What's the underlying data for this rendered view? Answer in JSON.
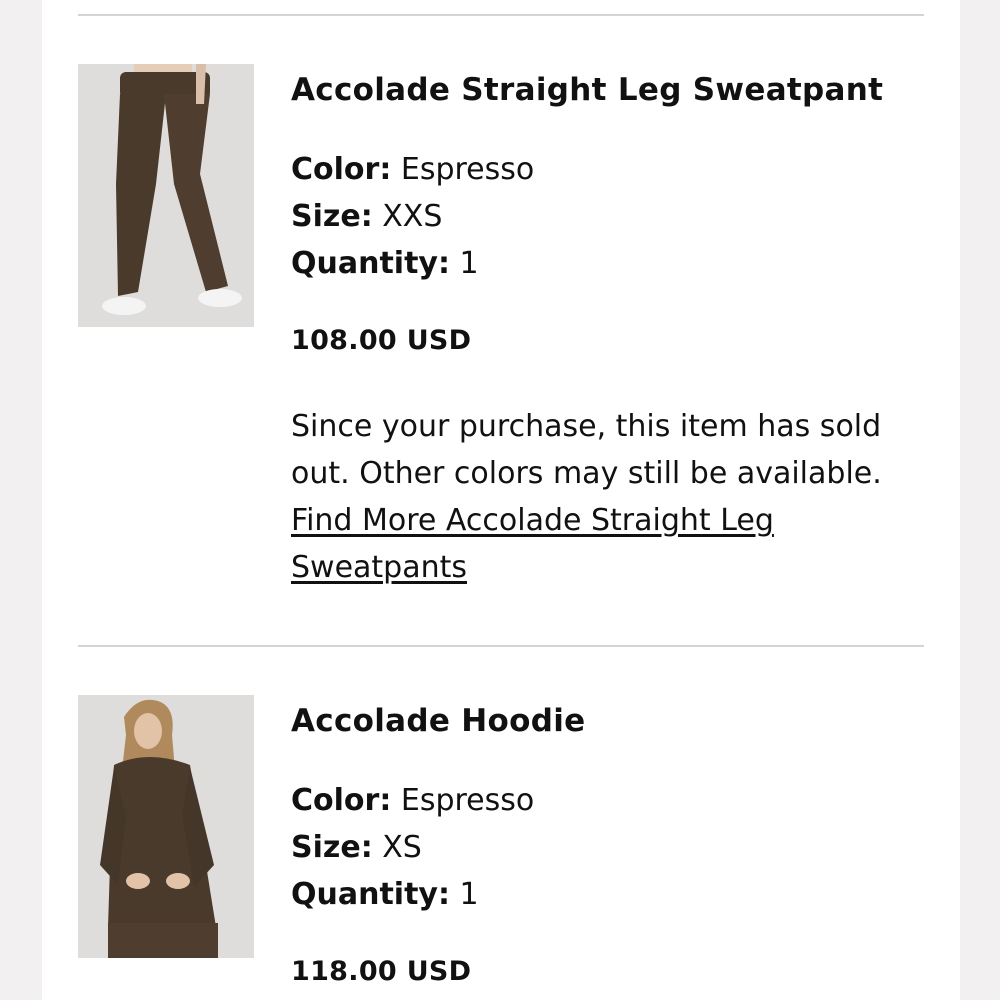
{
  "order_items": [
    {
      "title": "Accolade Straight Leg Sweatpant",
      "color_label": "Color:",
      "color_value": "Espresso",
      "size_label": "Size:",
      "size_value": "XXS",
      "quantity_label": "Quantity:",
      "quantity_value": "1",
      "price": "108.00 USD",
      "sold_out_message": "Since your purchase, this item has sold out. Other colors may still be available.",
      "find_more_link": "Find More Accolade Straight Leg Sweatpants",
      "image_icon": "product-photo-sweatpant"
    },
    {
      "title": "Accolade Hoodie",
      "color_label": "Color:",
      "color_value": "Espresso",
      "size_label": "Size:",
      "size_value": "XS",
      "quantity_label": "Quantity:",
      "quantity_value": "1",
      "price": "118.00 USD",
      "image_icon": "product-photo-hoodie"
    }
  ],
  "colors": {
    "page_background": "#ffffff",
    "outer_background": "#f2f0f0",
    "divider": "#d4d4d4",
    "text": "#111111",
    "product_espresso": "#4a3a2c",
    "photo_background": "#dcdcdc"
  }
}
